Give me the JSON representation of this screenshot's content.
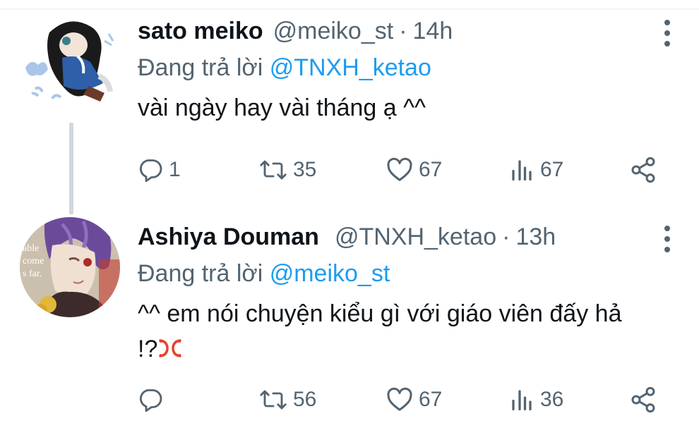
{
  "tweets": [
    {
      "display_name": "sato meiko",
      "handle": "@meiko_st",
      "separator": "·",
      "time": "14h",
      "reply_prefix": "Đang trả lời",
      "reply_to": "@TNXH_ketao",
      "text": "vài ngày hay vài tháng ạ ^^",
      "replies": "1",
      "retweets": "35",
      "likes": "67",
      "views": "67"
    },
    {
      "display_name": "Ashiya Douman",
      "handle": "@TNXH_ketao",
      "separator": "·",
      "time": "13h",
      "reply_prefix": "Đang trả lời",
      "reply_to": "@meiko_st",
      "text_line1": "^^ em nói chuyện kiểu gì với giáo viên đấy hả",
      "text_line2": "!?",
      "emoji": "anger-symbol",
      "replies": "",
      "retweets": "56",
      "likes": "67",
      "views": "36",
      "avatar_text": [
        "able",
        "come",
        "s far."
      ]
    }
  ],
  "colors": {
    "text": "#0f1419",
    "secondary": "#536471",
    "link": "#1d9bf0",
    "thread_line": "#cfd9de"
  },
  "icons": [
    "reply-icon",
    "retweet-icon",
    "like-icon",
    "views-icon",
    "share-icon",
    "more-icon"
  ]
}
